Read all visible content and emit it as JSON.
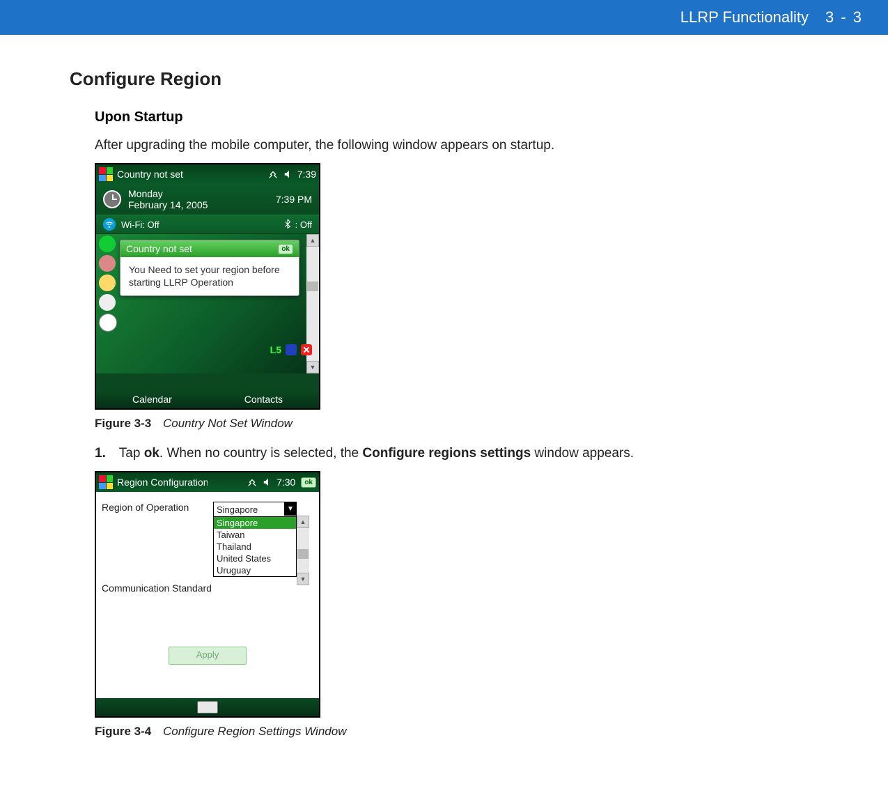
{
  "header": {
    "chapter": "LLRP Functionality",
    "page": "3 - 3"
  },
  "section_title": "Configure Region",
  "subsection_title": "Upon Startup",
  "intro_text": "After upgrading the mobile computer, the following window appears on startup.",
  "figure1": {
    "num": "Figure 3-3",
    "title": "Country Not Set Window"
  },
  "step1": {
    "num": "1.",
    "pre": "Tap ",
    "ok": "ok",
    "mid": ". When no country is selected, the ",
    "bold2": "Configure regions settings",
    "post": " window appears."
  },
  "figure2": {
    "num": "Figure 3-4",
    "title": "Configure Region Settings Window"
  },
  "shot1": {
    "title": "Country not set",
    "clock": "7:39",
    "day": "Monday",
    "date": "February 14, 2005",
    "time_pm": "7:39 PM",
    "wifi_label": "Wi-Fi: Off",
    "bt_label": ": Off",
    "popup_title": "Country not set",
    "popup_ok": "ok",
    "popup_body": "You Need to set your region before starting LLRP Operation",
    "status_lg": "L5",
    "soft_left": "Calendar",
    "soft_right": "Contacts"
  },
  "shot2": {
    "title": "Region Configuration",
    "clock": "7:30",
    "ok": "ok",
    "label_region": "Region of Operation",
    "label_comm": "Communication Standard",
    "selected": "Singapore",
    "options": [
      "Singapore",
      "Taiwan",
      "Thailand",
      "United States",
      "Uruguay"
    ],
    "apply": "Apply"
  }
}
